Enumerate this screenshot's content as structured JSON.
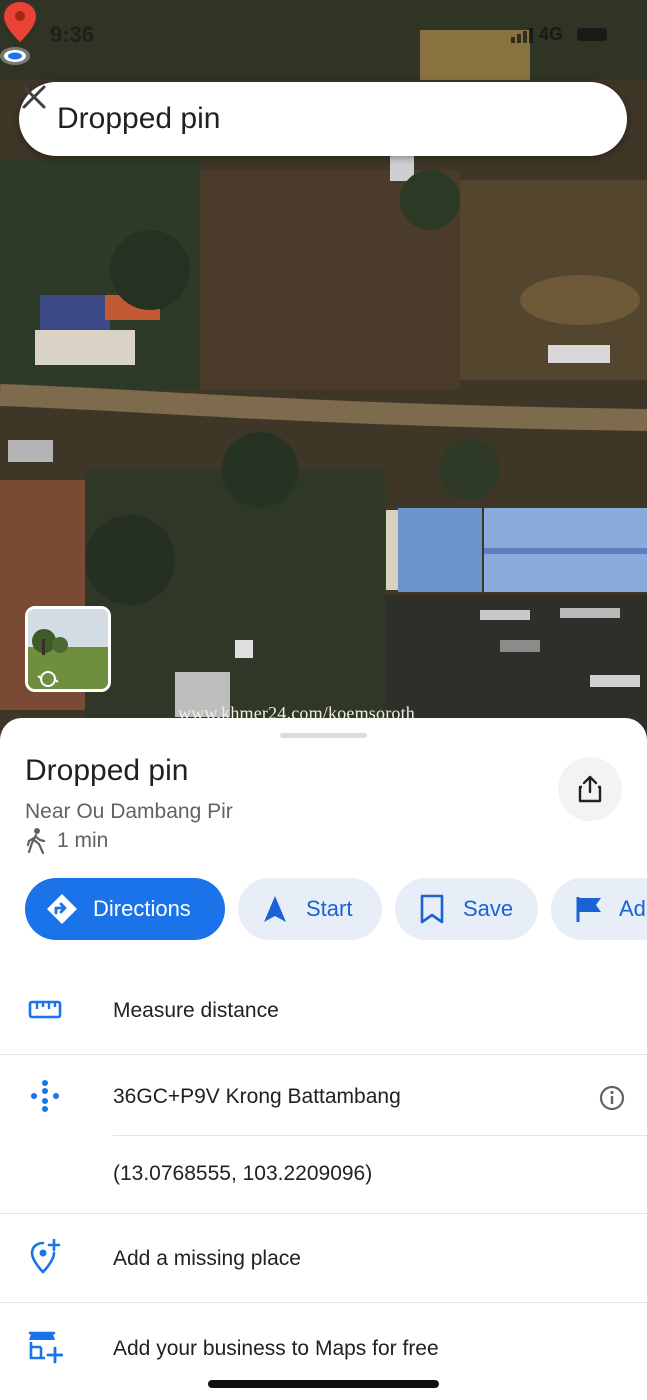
{
  "status_bar": {
    "time": "9:36",
    "network": "4G"
  },
  "search": {
    "title": "Dropped pin",
    "close_icon": "close-icon"
  },
  "map": {
    "watermark": "www.khmer24.com/koemsoroth",
    "street_view_thumbnail": "street-view-thumbnail"
  },
  "sheet": {
    "title": "Dropped pin",
    "subtitle": "Near Ou Dambang Pir",
    "walk_time": "1 min",
    "actions": [
      {
        "label": "Directions",
        "icon": "directions-icon"
      },
      {
        "label": "Start",
        "icon": "navigation-arrow-icon"
      },
      {
        "label": "Save",
        "icon": "bookmark-icon"
      },
      {
        "label": "Ad",
        "icon": "flag-icon"
      }
    ],
    "rows": {
      "measure": "Measure distance",
      "plus_code": "36GC+P9V Krong Battambang",
      "coordinates": "(13.0768555, 103.2209096)",
      "add_place": "Add a missing place",
      "add_business": "Add your business to Maps for free"
    }
  },
  "colors": {
    "accent": "#1a73e8",
    "chip_bg": "#e8eef7",
    "pin": "#ea4335"
  }
}
